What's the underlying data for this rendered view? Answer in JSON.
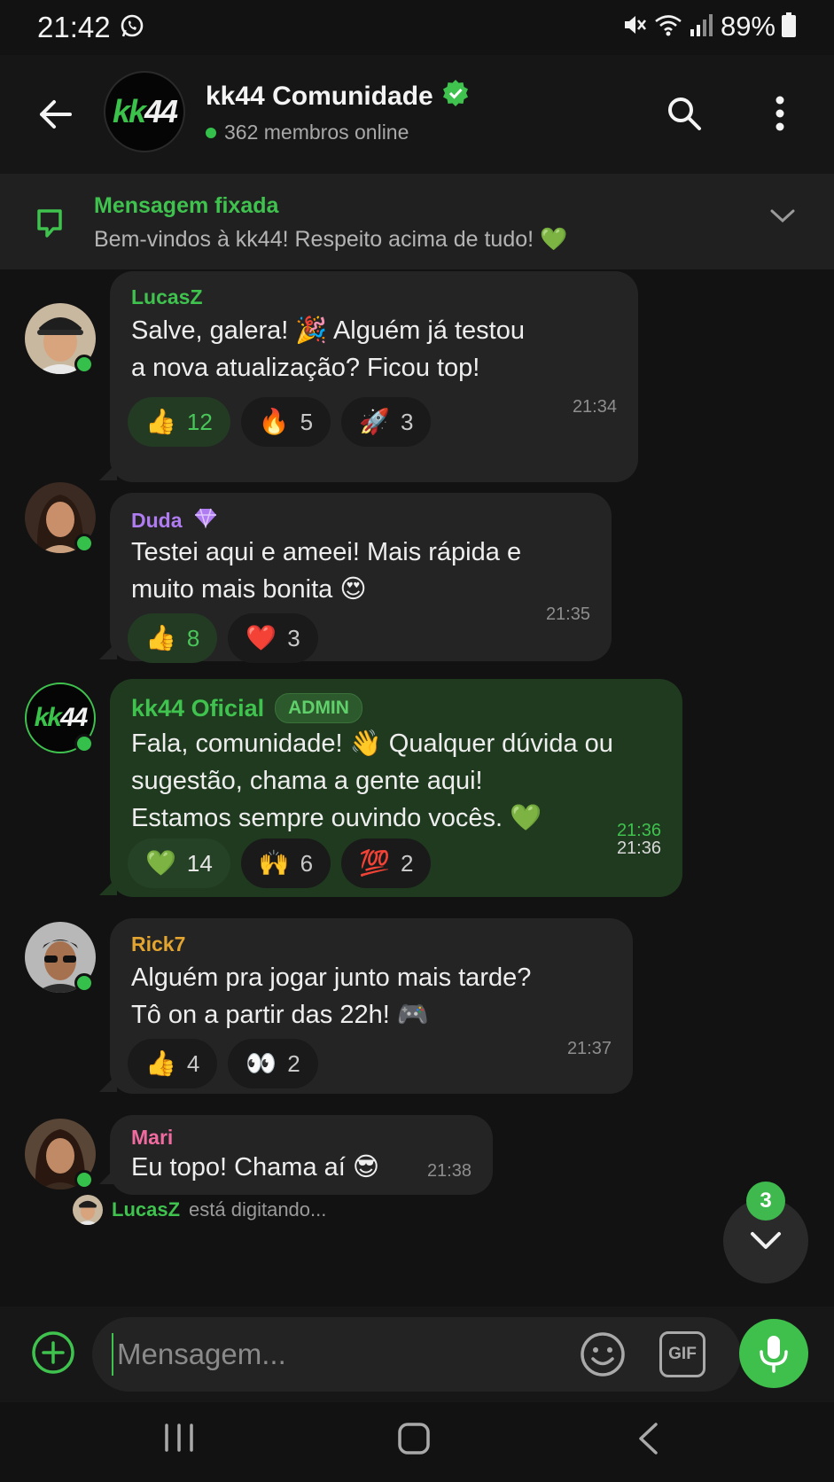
{
  "status_bar": {
    "time": "21:42",
    "battery": "89%"
  },
  "header": {
    "group_logo_left": "kk",
    "group_logo_right": "44",
    "group_name": "kk44 Comunidade",
    "online_text": "362 membros online"
  },
  "pinned": {
    "title": "Mensagem fixada",
    "text": "Bem-vindos à kk44! Respeito acima de tudo! 💚"
  },
  "messages": [
    {
      "sender": "LucasZ",
      "sender_color": "#3fc24e",
      "lines": [
        "Salve, galera! 🎉 Alguém já testou",
        "a nova atualização? Ficou top!"
      ],
      "time": "21:34",
      "reactions": [
        {
          "emoji": "👍",
          "count": "12",
          "highlight": true
        },
        {
          "emoji": "🔥",
          "count": "5"
        },
        {
          "emoji": "🚀",
          "count": "3"
        }
      ]
    },
    {
      "sender": "Duda",
      "sender_color": "#b07cf2",
      "badge_icon": "diamond-icon",
      "lines": [
        "Testei aqui e ameei! Mais rápida e",
        "muito mais bonita 😍"
      ],
      "time": "21:35",
      "reactions": [
        {
          "emoji": "👍",
          "count": "8",
          "highlight": true
        },
        {
          "emoji": "❤️",
          "count": "3"
        }
      ]
    },
    {
      "sender": "kk44 Oficial",
      "sender_color": "#3fc24e",
      "badge_text": "ADMIN",
      "lines": [
        "Fala, comunidade! 👋 Qualquer dúvida ou",
        "sugestão, chama a gente aqui!",
        "Estamos sempre ouvindo vocês. 💚"
      ],
      "time_top": "21:36",
      "time": "21:36",
      "reactions": [
        {
          "emoji": "💚",
          "count": "14",
          "highlight": true
        },
        {
          "emoji": "🙌",
          "count": "6"
        },
        {
          "emoji": "💯",
          "count": "2"
        }
      ]
    },
    {
      "sender": "Rick7",
      "sender_color": "#e3a530",
      "lines": [
        "Alguém pra jogar junto mais tarde?",
        "Tô on a partir das 22h! 🎮"
      ],
      "time": "21:37",
      "reactions": [
        {
          "emoji": "👍",
          "count": "4"
        },
        {
          "emoji": "👀",
          "count": "2"
        }
      ]
    },
    {
      "sender": "Mari",
      "sender_color": "#f06ca0",
      "lines": [
        "Eu topo! Chama aí 😎"
      ],
      "time": "21:38"
    }
  ],
  "typing": {
    "name": "LucasZ",
    "text": "está digitando..."
  },
  "scroll_fab": {
    "unread_count": "3"
  },
  "composer": {
    "placeholder": "Mensagem...",
    "gif_label": "GIF"
  },
  "colors": {
    "accent": "#3fc24e",
    "background": "#121212",
    "bubble": "#242424",
    "admin_bubble": "#1f3a1f"
  }
}
